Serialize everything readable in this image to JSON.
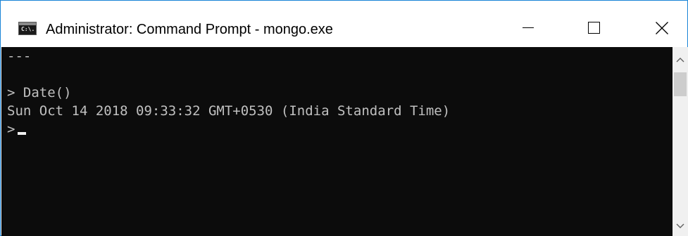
{
  "window": {
    "title": "Administrator: Command Prompt - mongo.exe",
    "icon_name": "command-prompt-icon",
    "icon_glyph": "C:\\.",
    "accent_border_color": "#1883d7"
  },
  "controls": {
    "minimize_icon": "minimize-icon",
    "maximize_icon": "maximize-icon",
    "close_icon": "close-icon"
  },
  "console": {
    "background_color": "#0c0c0c",
    "text_color": "#c0c0c0",
    "lines": [
      "---",
      "",
      "> Date()",
      "Sun Oct 14 2018 09:33:32 GMT+0530 (India Standard Time)",
      ">"
    ],
    "cursor_visible": true
  },
  "scrollbar": {
    "up_icon": "chevron-up-icon",
    "down_icon": "chevron-down-icon"
  }
}
